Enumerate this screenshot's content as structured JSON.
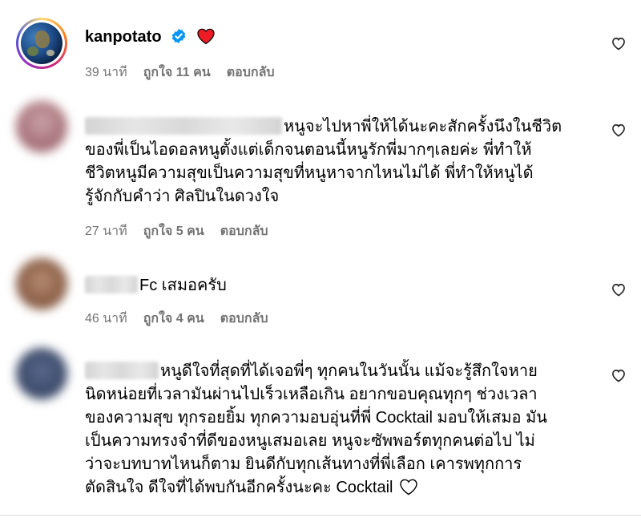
{
  "comments": [
    {
      "username": "kanpotato",
      "text": "",
      "time": "39 นาที",
      "likes": "ถูกใจ 11 คน",
      "reply": "ตอบกลับ"
    },
    {
      "username": "",
      "text_lines": [
        "หนูจะไปหาพี่ให้ได้นะคะสักครั้งนึงในชีวิต",
        "ของพี่เป็นไอดอลหนูตั้งแต่เด็กจนตอนนี้หนูรักพี่มากๆเลยค่ะ พี่ทำให้",
        "ชีวิตหนูมีความสุขเป็นความสุขที่หนูหาจากไหนไม่ได้ พี่ทำให้หนูได้",
        "รู้จักกับคำว่า ศิลปินในดวงใจ"
      ],
      "time": "27 นาที",
      "likes": "ถูกใจ 5 คน",
      "reply": "ตอบกลับ"
    },
    {
      "username": "",
      "text": "Fc เสมอครับ",
      "time": "46 นาที",
      "likes": "ถูกใจ 4 คน",
      "reply": "ตอบกลับ"
    },
    {
      "username": "",
      "text_lines": [
        "หนูดีใจที่สุดที่ได้เจอพี่ๆ ทุกคนในวันนั้น แม้จะรู้สึกใจหาย",
        "นิดหน่อยที่เวลามันผ่านไปเร็วเหลือเกิน อยากขอบคุณทุกๆ ช่วงเวลา",
        "ของความสุข ทุกรอยยิ้ม ทุกความอบอุ่นที่พี่ Cocktail มอบให้เสมอ มัน",
        "เป็นความทรงจำที่ดีของหนูเสมอเลย หนูจะซัพพอร์ตทุกคนต่อไป ไม่",
        "ว่าจะบทบาทไหนก็ตาม ยินดีกับทุกเส้นทางที่พี่เลือก เคารพทุกการ",
        "ตัดสินใจ ดีใจที่ได้พบกันอีกครั้งนะคะ Cocktail"
      ]
    }
  ],
  "colors": {
    "meta": "#737373",
    "verified": "#0095f6",
    "heart_red": "#ed1c24"
  },
  "icons": {
    "like": "heart-outline-icon",
    "verified": "verified-badge-icon"
  }
}
